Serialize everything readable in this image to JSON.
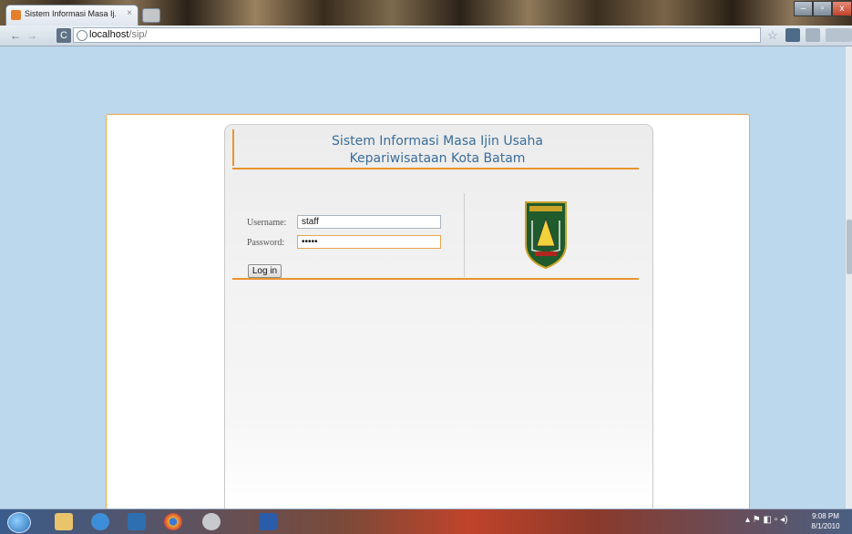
{
  "browser": {
    "tab_title": "Sistem Informasi Masa Ij...",
    "tab_close": "×",
    "url_host": "localhost",
    "url_path": "/sip/",
    "back_glyph": "←",
    "forward_glyph": "→",
    "reload_glyph": "C",
    "star_glyph": "☆",
    "win_min": "–",
    "win_max": "▫",
    "win_close": "x"
  },
  "app": {
    "title_line1": "Sistem Informasi Masa Ijin Usaha",
    "title_line2": "Kepariwisataan Kota Batam",
    "username_label": "Username:",
    "password_label": "Password:",
    "username_value": "staff",
    "password_value": "•••••",
    "login_label": "Log in",
    "colors": {
      "accent": "#e8942e",
      "title": "#3a6d9a",
      "page_bg": "#bcd8ec"
    }
  },
  "taskbar": {
    "time": "9:08 PM",
    "date": "8/1/2010",
    "tray_glyphs": "▴  ⚑  ◧  ▫  ◂)"
  }
}
